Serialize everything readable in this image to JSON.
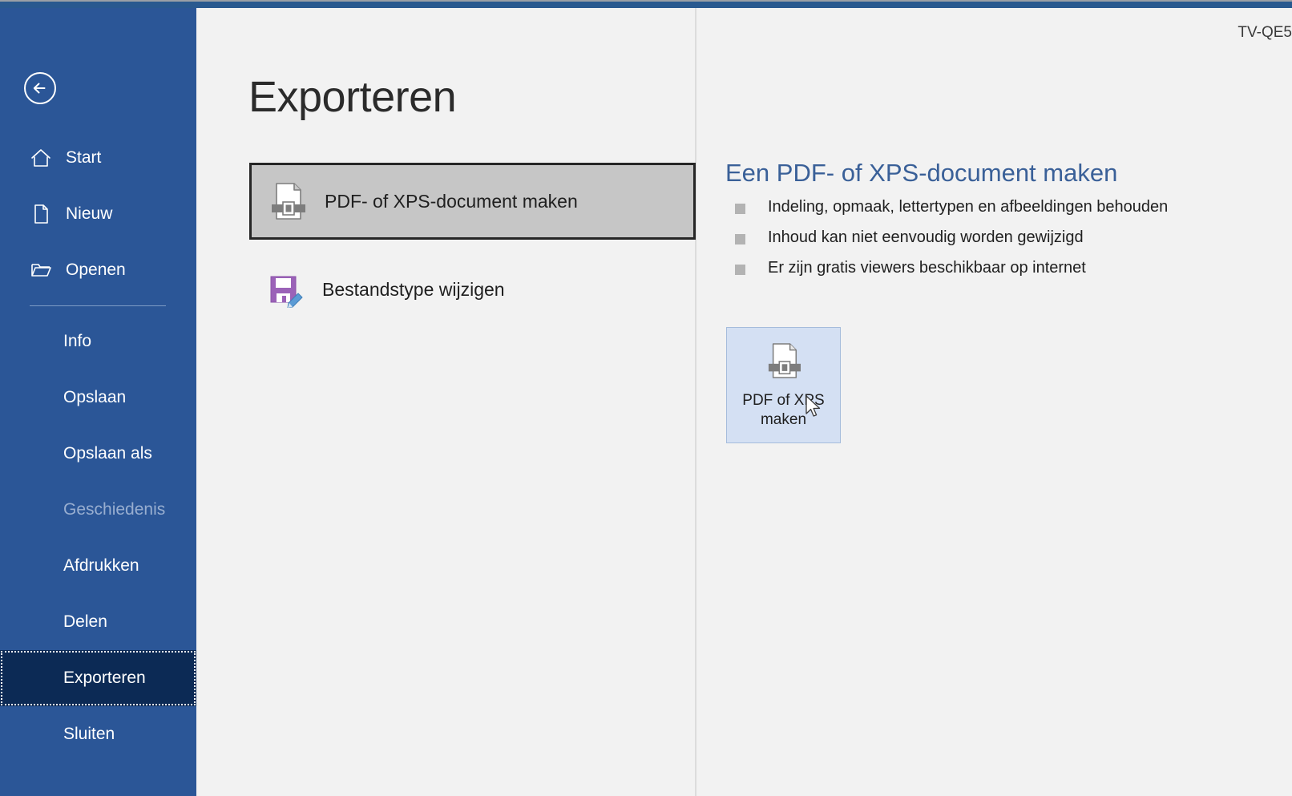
{
  "window": {
    "machine_label": "TV-QE5",
    "accent_color": "#29598f",
    "sidebar_color": "#2b5697",
    "active_item_color": "#0c2a55",
    "content_bg": "#f2f2f2"
  },
  "sidebar": {
    "back_icon": "back-arrow-icon",
    "items": [
      {
        "label": "Start",
        "icon": "home-icon",
        "state": "normal"
      },
      {
        "label": "Nieuw",
        "icon": "page-icon",
        "state": "normal"
      },
      {
        "label": "Openen",
        "icon": "folder-icon",
        "state": "normal"
      },
      {
        "label": "Info",
        "icon": "",
        "state": "normal"
      },
      {
        "label": "Opslaan",
        "icon": "",
        "state": "normal"
      },
      {
        "label": "Opslaan als",
        "icon": "",
        "state": "normal"
      },
      {
        "label": "Geschiedenis",
        "icon": "",
        "state": "disabled"
      },
      {
        "label": "Afdrukken",
        "icon": "",
        "state": "normal"
      },
      {
        "label": "Delen",
        "icon": "",
        "state": "normal"
      },
      {
        "label": "Exporteren",
        "icon": "",
        "state": "active"
      },
      {
        "label": "Sluiten",
        "icon": "",
        "state": "normal"
      }
    ]
  },
  "main": {
    "title": "Exporteren",
    "options": [
      {
        "label": "PDF- of XPS-document maken",
        "icon": "pdf-document-icon",
        "selected": true
      },
      {
        "label": "Bestandstype wijzigen",
        "icon": "save-edit-icon",
        "selected": false
      }
    ]
  },
  "detail": {
    "title": "Een PDF- of XPS-document maken",
    "bullets": [
      "Indeling, opmaak, lettertypen en afbeeldingen behouden",
      "Inhoud kan niet eenvoudig worden gewijzigd",
      "Er zijn gratis viewers beschikbaar op internet"
    ],
    "action": {
      "icon": "pdf-document-icon",
      "label_line1": "PDF of XPS",
      "label_line2": "maken",
      "fill_color": "#d4e0f3",
      "border_color": "#a5bcdc"
    }
  }
}
